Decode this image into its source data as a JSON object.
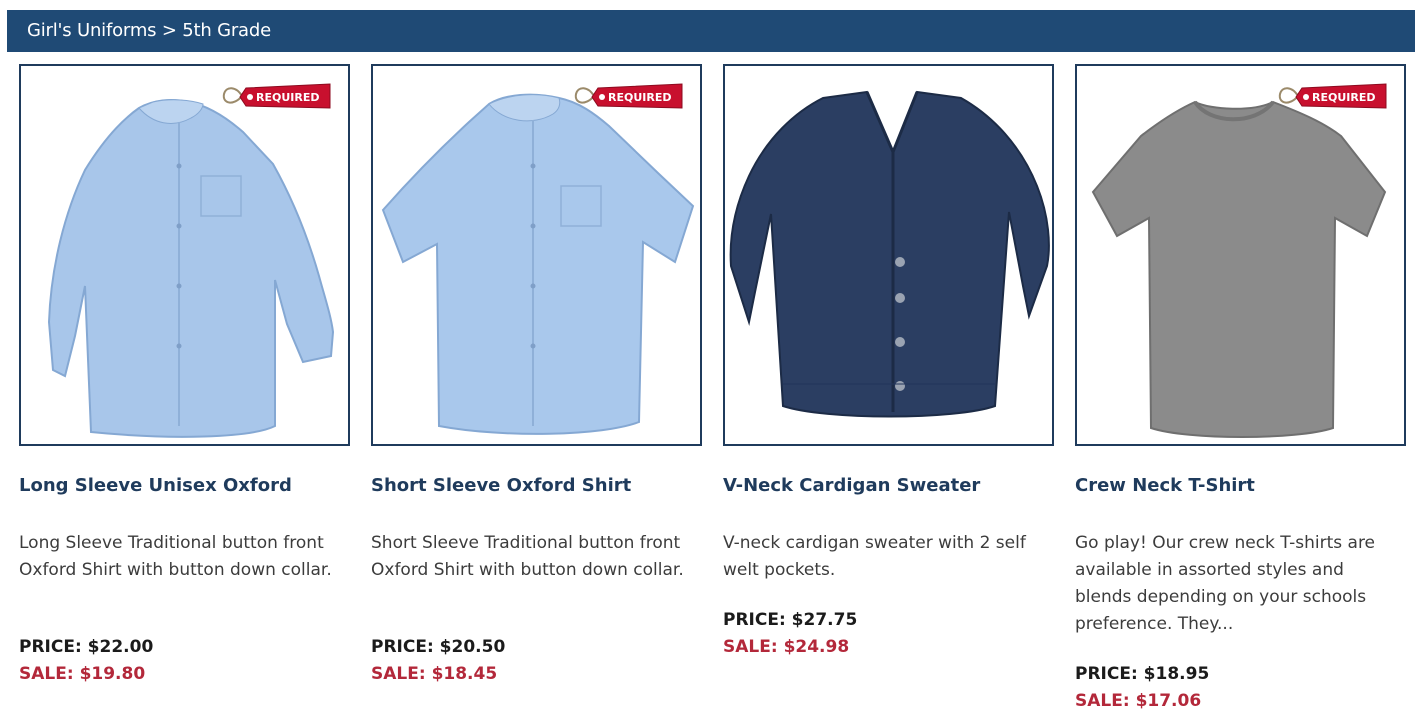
{
  "breadcrumb": "Girl's Uniforms > 5th Grade",
  "required_badge": "REQUIRED",
  "colors": {
    "header": "#1f4a75",
    "title": "#1f3b5c",
    "sale": "#b3283a",
    "badge": "#c8102e"
  },
  "products": [
    {
      "name": "Long Sleeve Unisex Oxford",
      "description": "Long Sleeve Traditional button front Oxford Shirt with button down collar.",
      "price": "PRICE: $22.00",
      "sale": "SALE: $19.80",
      "image": "light-blue-long-sleeve-oxford-shirt",
      "required": true
    },
    {
      "name": "Short Sleeve Oxford Shirt",
      "description": "Short Sleeve Traditional button front Oxford Shirt with button down collar.",
      "price": "PRICE: $20.50",
      "sale": "SALE: $18.45",
      "image": "light-blue-short-sleeve-oxford-shirt",
      "required": true
    },
    {
      "name": "V-Neck Cardigan Sweater",
      "description": "V-neck cardigan sweater with 2 self welt pockets.",
      "price": "PRICE: $27.75",
      "sale": "SALE: $24.98",
      "image": "navy-v-neck-cardigan",
      "required": false
    },
    {
      "name": "Crew Neck T-Shirt",
      "description": "Go play! Our crew neck T-shirts are available in assorted styles and blends depending on your schools preference. They...",
      "price": "PRICE: $18.95",
      "sale": "SALE: $17.06",
      "image": "gray-crew-neck-t-shirt",
      "required": true
    }
  ]
}
